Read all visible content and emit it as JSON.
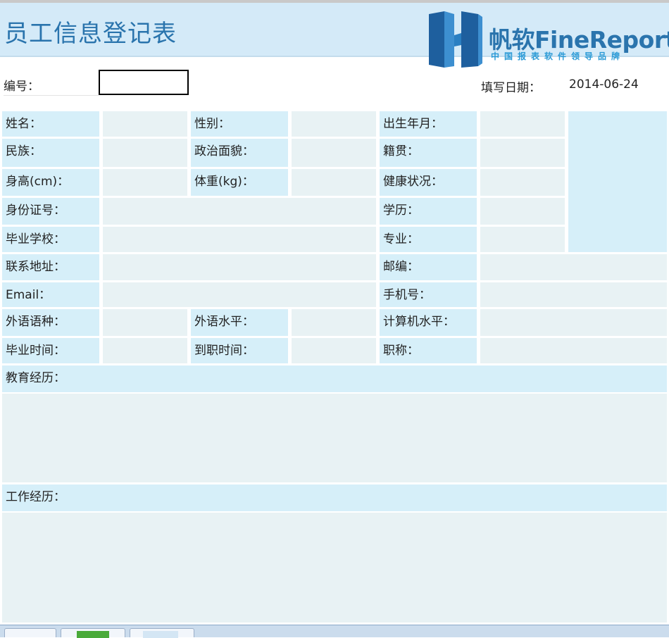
{
  "header": {
    "title": "员工信息登记表",
    "brand": "帆软FineReport",
    "slogan": "中国报表软件领导品牌"
  },
  "meta": {
    "id_label": "编号：",
    "id_value": "",
    "date_label": "填写日期：",
    "date_value": "2014-06-24"
  },
  "form": {
    "name": "姓名：",
    "gender": "性别：",
    "birth": "出生年月：",
    "ethnicity": "民族：",
    "political": "政治面貌：",
    "native_place": "籍贯：",
    "height": "身高(cm)：",
    "weight": "体重(kg)：",
    "health": "健康状况：",
    "id_card": "身份证号：",
    "education": "学历：",
    "school": "毕业学校：",
    "major": "专业：",
    "address": "联系地址：",
    "postcode": "邮编：",
    "email": "Email：",
    "mobile": "手机号：",
    "language": "外语语种：",
    "language_level": "外语水平：",
    "computer_level": "计算机水平：",
    "grad_time": "毕业时间：",
    "join_time": "到职时间：",
    "title": "职称：",
    "edu_history": "教育经历：",
    "work_history": "工作经历："
  }
}
